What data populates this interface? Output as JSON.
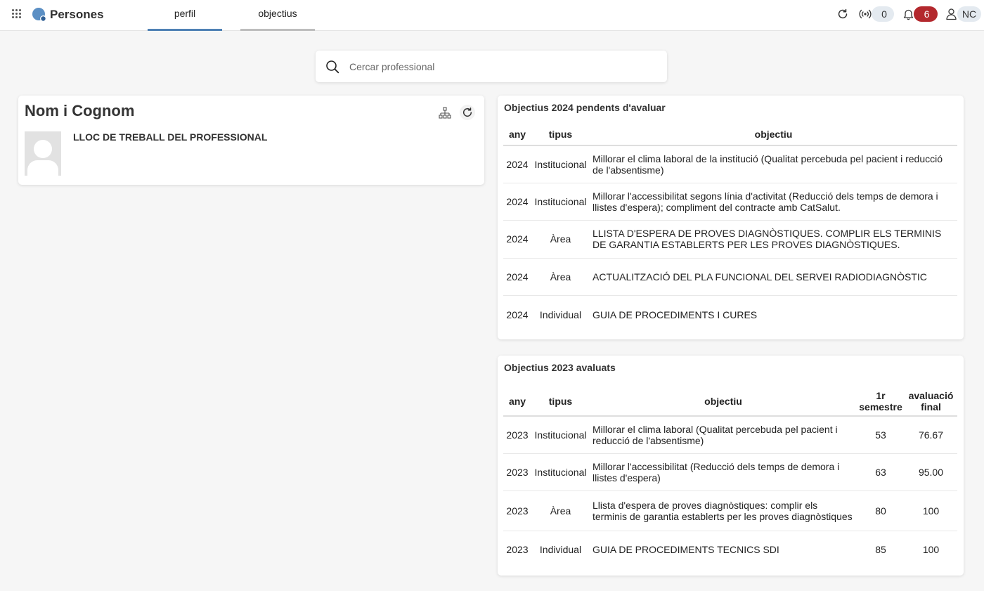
{
  "header": {
    "app_title": "Persones",
    "tabs": [
      {
        "label": "perfil"
      },
      {
        "label": "objectius"
      }
    ],
    "connections_count": "0",
    "notifications_count": "6",
    "user_initials": "NC"
  },
  "search": {
    "placeholder": "Cercar professional"
  },
  "profile": {
    "name": "Nom i Cognom",
    "job_title": "LLOC DE TREBALL DEL PROFESSIONAL"
  },
  "pending_objectives": {
    "title": "Objectius 2024 pendents d'avaluar",
    "columns": [
      "any",
      "tipus",
      "objectiu"
    ],
    "rows": [
      {
        "any": "2024",
        "tipus": "Institucional",
        "objectiu": "Millorar el clima laboral de la institució (Qualitat percebuda pel pacient i reducció de l'absentisme)"
      },
      {
        "any": "2024",
        "tipus": "Institucional",
        "objectiu": "Millorar l'accessibilitat segons línia d'activitat (Reducció dels temps de demora i llistes d'espera); compliment del contracte amb CatSalut."
      },
      {
        "any": "2024",
        "tipus": "Àrea",
        "objectiu": "LLISTA D'ESPERA DE PROVES DIAGNÒSTIQUES. COMPLIR ELS TERMINIS DE GARANTIA ESTABLERTS PER LES PROVES DIAGNÒSTIQUES."
      },
      {
        "any": "2024",
        "tipus": "Àrea",
        "objectiu": "ACTUALITZACIÓ DEL PLA FUNCIONAL DEL SERVEI RADIODIAGNÒSTIC"
      },
      {
        "any": "2024",
        "tipus": "Individual",
        "objectiu": "GUIA DE PROCEDIMENTS I CURES"
      }
    ]
  },
  "evaluated_objectives": {
    "title": "Objectius 2023 avaluats",
    "columns": [
      "any",
      "tipus",
      "objectiu",
      "1r semestre",
      "avaluació final"
    ],
    "rows": [
      {
        "any": "2023",
        "tipus": "Institucional",
        "objectiu": "Millorar el clima laboral (Qualitat percebuda pel pacient i reducció de l'absentisme)",
        "semestre": "53",
        "final": "76.67"
      },
      {
        "any": "2023",
        "tipus": "Institucional",
        "objectiu": "Millorar l'accessibilitat (Reducció dels temps de demora i llistes d'espera)",
        "semestre": "63",
        "final": "95.00"
      },
      {
        "any": "2023",
        "tipus": "Àrea",
        "objectiu": "Llista d'espera de proves diagnòstiques: complir els terminis de garantia establerts per les proves diagnòstiques",
        "semestre": "80",
        "final": "100"
      },
      {
        "any": "2023",
        "tipus": "Individual",
        "objectiu": "GUIA DE PROCEDIMENTS TECNICS SDI",
        "semestre": "85",
        "final": "100"
      }
    ]
  },
  "colors": {
    "accent": "#4f81b5",
    "notification": "#b3282d",
    "pill_bg": "#e4eaf0"
  },
  "icons": [
    "apps-grid-icon",
    "logo-icon",
    "refresh-icon",
    "broadcast-icon",
    "bell-icon",
    "user-icon",
    "search-icon",
    "org-chart-icon",
    "avatar-placeholder-icon"
  ]
}
